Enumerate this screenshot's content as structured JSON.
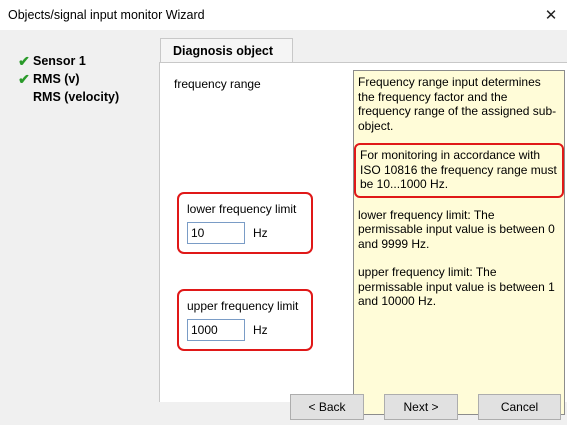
{
  "window": {
    "title": "Objects/signal input monitor Wizard",
    "close_glyph": "✕"
  },
  "sidebar": {
    "steps": [
      {
        "label": "Sensor 1",
        "checked": true
      },
      {
        "label": "RMS (v)",
        "checked": true
      },
      {
        "label": "RMS (velocity)",
        "checked": false
      }
    ],
    "check_glyph": "✔",
    "check_color": "#2a9a2a"
  },
  "tab": {
    "label": "Diagnosis object"
  },
  "form": {
    "section_label": "frequency range",
    "lower": {
      "label": "lower frequency limit",
      "value": "10",
      "unit": "Hz"
    },
    "upper": {
      "label": "upper frequency limit",
      "value": "1000",
      "unit": "Hz"
    }
  },
  "info": {
    "p1": "Frequency range input determines the frequency factor and the frequency range of the assigned sub-object.",
    "p2": "For monitoring in accordance with ISO 10816 the frequency range must be 10...1000 Hz.",
    "p3": "lower frequency limit: The permissable input value is between 0 and 9999 Hz.",
    "p4": "upper frequency limit: The permissable input value is between 1 and 10000 Hz."
  },
  "buttons": {
    "back": "< Back",
    "next": "Next >",
    "cancel": "Cancel"
  },
  "colors": {
    "highlight": "#e01818",
    "info_background": "#fffcd8",
    "dialog_background": "#f0f0f0"
  }
}
